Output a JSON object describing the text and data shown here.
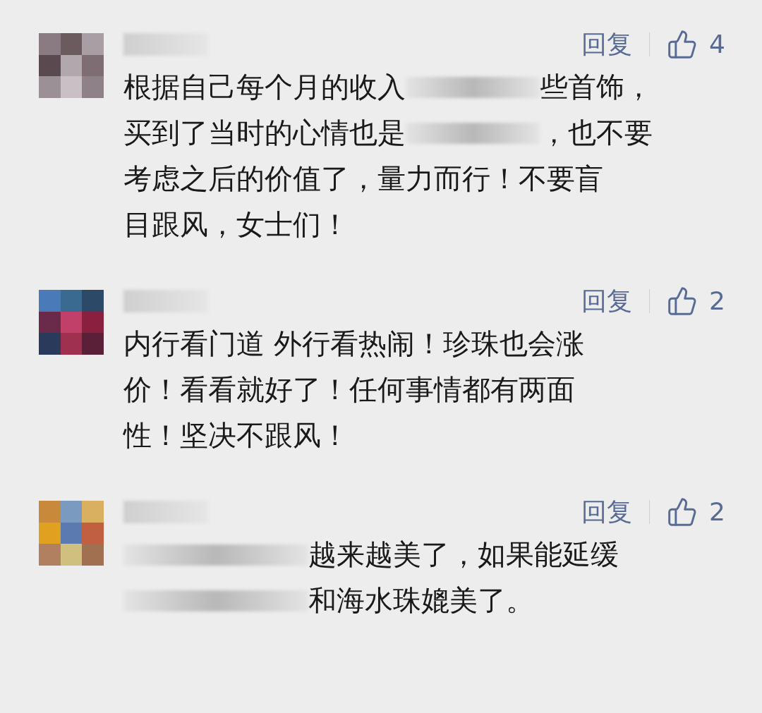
{
  "comments": [
    {
      "reply": "回复",
      "likes": "4",
      "lines": [
        [
          {
            "kind": "text",
            "text": "根据自己每个月的收入"
          },
          {
            "kind": "redacted"
          },
          {
            "kind": "text",
            "text": "些首饰，"
          }
        ],
        [
          {
            "kind": "text",
            "text": "买到了当时的心情也是"
          },
          {
            "kind": "redacted"
          },
          {
            "kind": "text",
            "text": "，也不要"
          }
        ],
        [
          {
            "kind": "text",
            "text": "考虑之后的价值了，量力而行！不要盲"
          }
        ],
        [
          {
            "kind": "text",
            "text": "目跟风，女士们！"
          }
        ]
      ]
    },
    {
      "reply": "回复",
      "likes": "2",
      "lines": [
        [
          {
            "kind": "text",
            "text": "内行看门道 外行看热闹！珍珠也会涨"
          }
        ],
        [
          {
            "kind": "text",
            "text": "价！看看就好了！任何事情都有两面"
          }
        ],
        [
          {
            "kind": "text",
            "text": "性！坚决不跟风！"
          }
        ]
      ]
    },
    {
      "reply": "回复",
      "likes": "2",
      "lines": [
        [
          {
            "kind": "redacted"
          },
          {
            "kind": "text",
            "text": "越来越美了，如果能延缓"
          }
        ],
        [
          {
            "kind": "redacted"
          },
          {
            "kind": "text",
            "text": "和海水珠媲美了。"
          }
        ]
      ]
    }
  ]
}
